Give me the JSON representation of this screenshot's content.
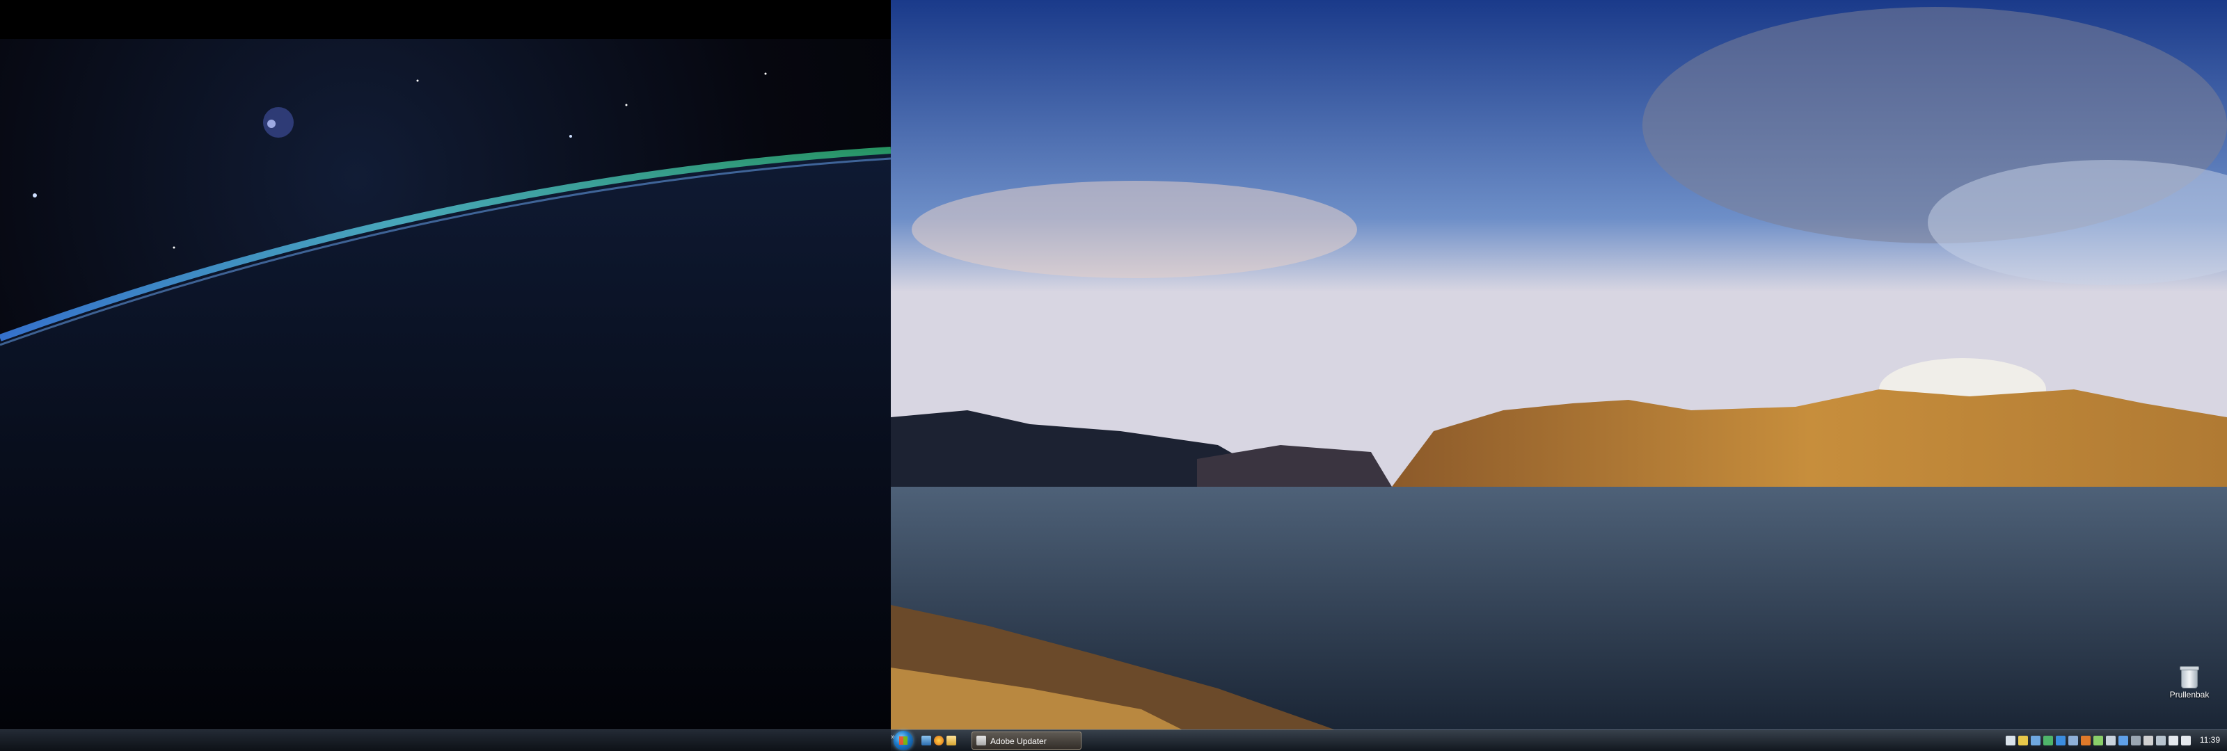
{
  "taskbar": {
    "quick_launch_more": "»",
    "task_button_label": "Adobe Updater",
    "clock": "11:39"
  },
  "desktop": {
    "recycle_bin_label": "Prullenbak"
  },
  "tray_icons": [
    "keyboard-icon",
    "note-icon",
    "app-icon",
    "chat-icon",
    "dropbox-icon",
    "info-icon",
    "firefox-icon",
    "network-monitor-icon",
    "user-icon",
    "security-icon",
    "tools-icon",
    "sync-icon",
    "signal-icon",
    "volume-icon",
    "flag-icon"
  ],
  "colors": {
    "taskbar": "#1c2430",
    "accent": "#1b78c8"
  }
}
